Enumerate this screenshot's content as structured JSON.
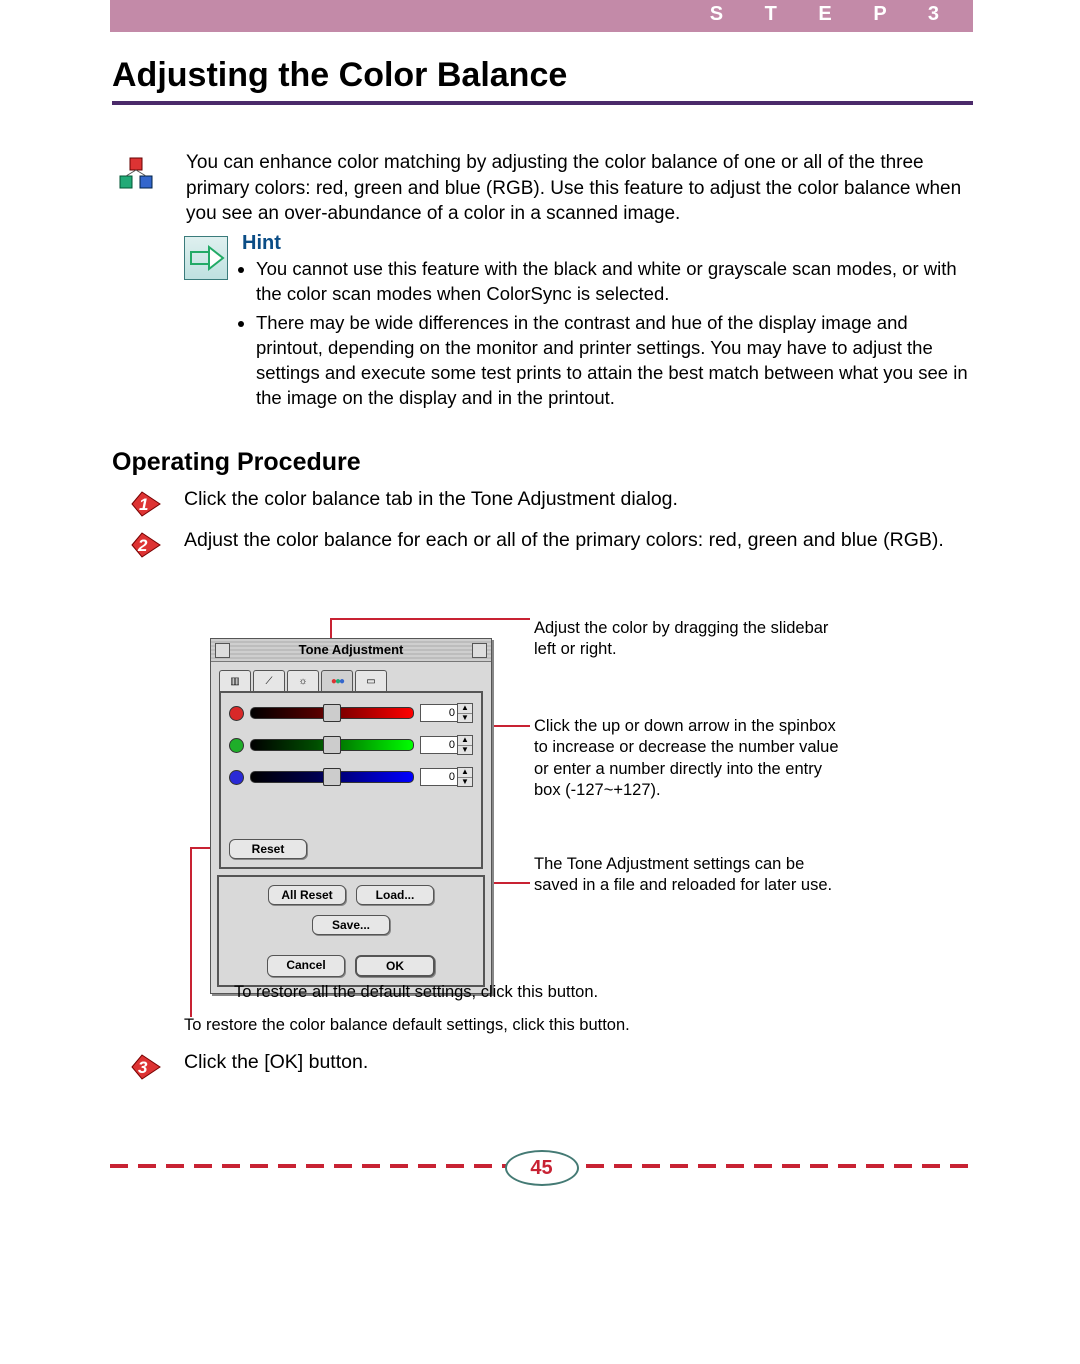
{
  "header": {
    "step_label": "S T E P   3"
  },
  "title": "Adjusting the Color Balance",
  "intro": "You can enhance color matching by adjusting the color balance of one or all of the three primary colors: red, green and blue (RGB). Use this feature to adjust the color balance when you see an over-abundance of a color in a scanned image.",
  "hint": {
    "label": "Hint",
    "items": [
      "You cannot use this feature with the black and white or grayscale scan modes, or with the color scan modes when ColorSync is selected.",
      "There may be wide differences in the contrast and hue of the display image and printout, depending on the monitor and printer settings. You may have to adjust the settings and execute some test prints to attain the best match between what you see in the image on the display and in the printout."
    ]
  },
  "procedure": {
    "heading": "Operating Procedure",
    "steps": [
      {
        "num": "1",
        "text": "Click the color balance tab in the Tone Adjustment dialog."
      },
      {
        "num": "2",
        "text": "Adjust the color balance for each or all of the primary colors: red, green and blue (RGB)."
      },
      {
        "num": "3",
        "text": "Click the [OK] button."
      }
    ]
  },
  "dialog": {
    "title": "Tone Adjustment",
    "sliders": {
      "red": {
        "value": "0"
      },
      "green": {
        "value": "0"
      },
      "blue": {
        "value": "0"
      }
    },
    "buttons": {
      "reset": "Reset",
      "all_reset": "All Reset",
      "load": "Load...",
      "save": "Save...",
      "cancel": "Cancel",
      "ok": "OK"
    }
  },
  "callouts": {
    "slidebar": "Adjust the color by dragging the slidebar left or right.",
    "spinbox": "Click the up or down arrow in the spinbox to increase or decrease the number value or enter a number directly into the entry box (-127~+127).",
    "saveload": "The Tone Adjustment settings can be saved in a file and reloaded for later use.",
    "allreset_caption": "To restore all the default settings, click this button.",
    "reset_caption": "To restore the color balance default settings, click this button."
  },
  "page_number": "45"
}
